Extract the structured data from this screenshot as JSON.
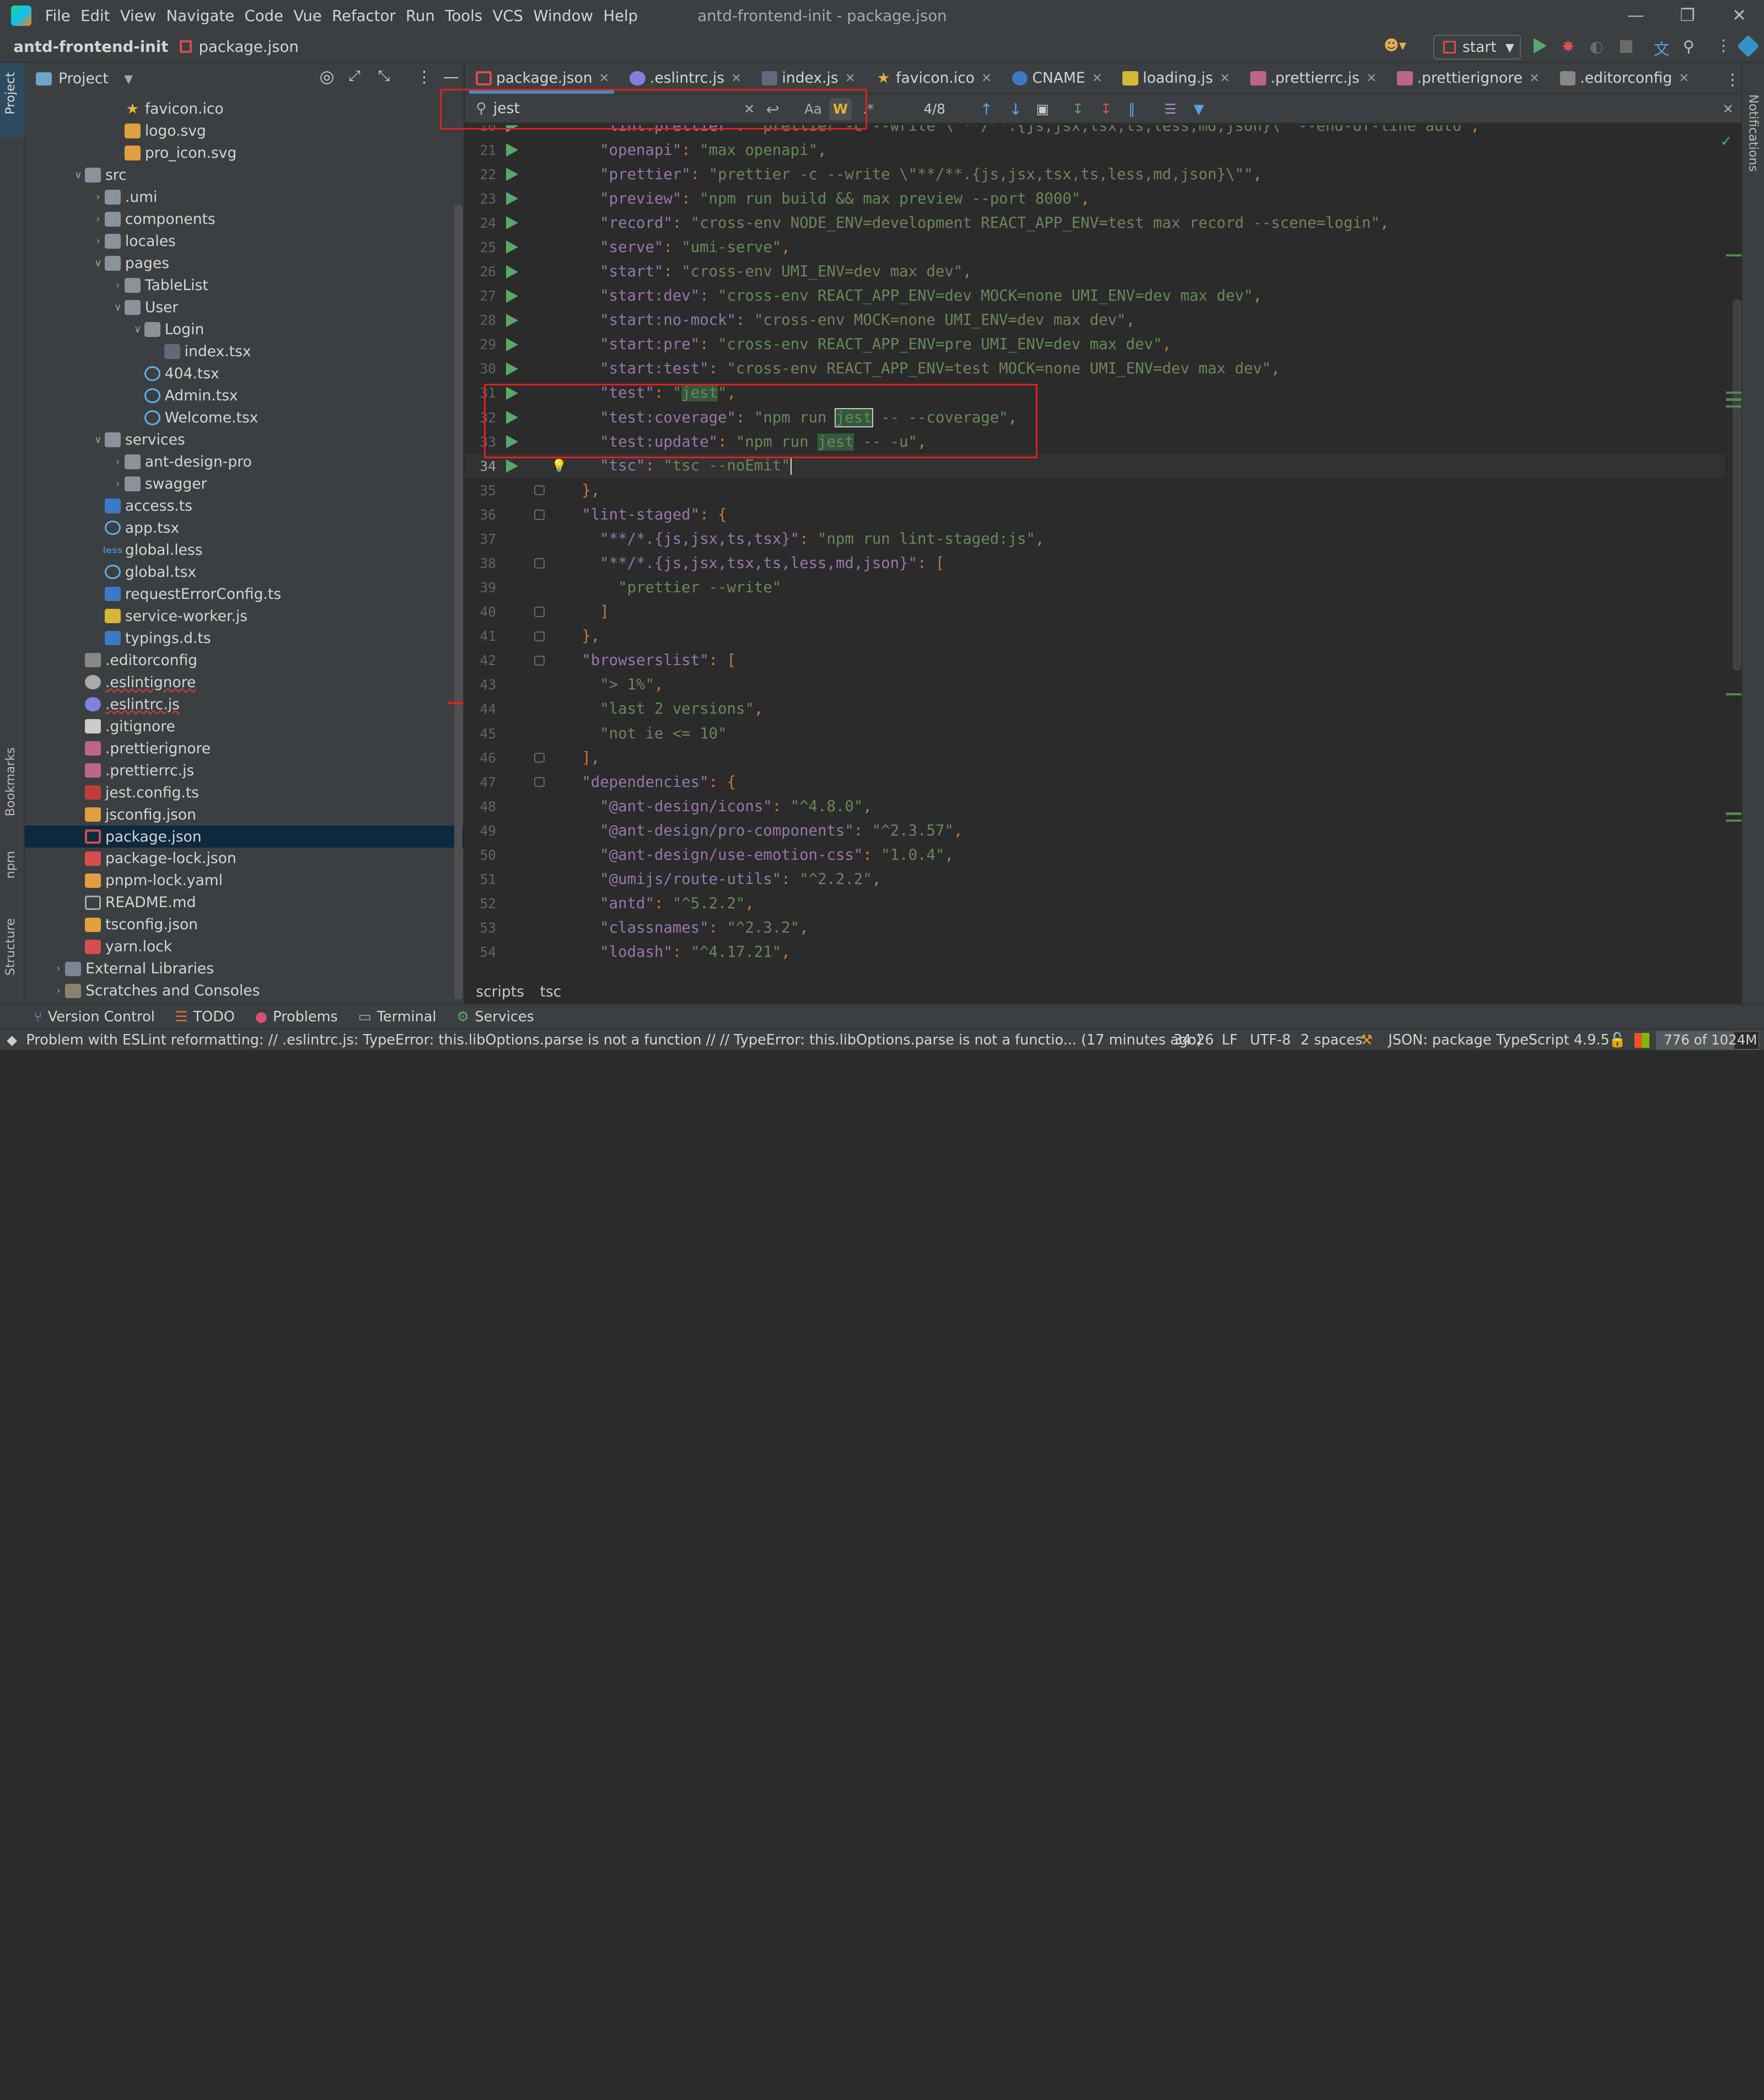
{
  "window_title": "antd-frontend-init - package.json",
  "menu": [
    "File",
    "Edit",
    "View",
    "Navigate",
    "Code",
    "Vue",
    "Refactor",
    "Run",
    "Tools",
    "VCS",
    "Window",
    "Help"
  ],
  "breadcrumb": {
    "project": "antd-frontend-init",
    "file": "package.json"
  },
  "run_config": "start",
  "left_strip": {
    "project": "Project",
    "bookmarks": "Bookmarks",
    "npm": "npm",
    "structure": "Structure"
  },
  "right_strip": {
    "notifications": "Notifications"
  },
  "project_panel": {
    "title": "Project"
  },
  "tree": [
    {
      "label": "favicon.ico",
      "depth": 3,
      "icon": "star-icon",
      "arrow": ""
    },
    {
      "label": "logo.svg",
      "depth": 3,
      "icon": "svg-icon",
      "arrow": ""
    },
    {
      "label": "pro_icon.svg",
      "depth": 3,
      "icon": "svg-icon",
      "arrow": ""
    },
    {
      "label": "src",
      "depth": 1,
      "icon": "folder-icon",
      "arrow": "down"
    },
    {
      "label": ".umi",
      "depth": 2,
      "icon": "folder-icon",
      "arrow": "right"
    },
    {
      "label": "components",
      "depth": 2,
      "icon": "folder-icon",
      "arrow": "right"
    },
    {
      "label": "locales",
      "depth": 2,
      "icon": "folder-icon",
      "arrow": "right"
    },
    {
      "label": "pages",
      "depth": 2,
      "icon": "folder-icon",
      "arrow": "down"
    },
    {
      "label": "TableList",
      "depth": 3,
      "icon": "folder-icon",
      "arrow": "right"
    },
    {
      "label": "User",
      "depth": 3,
      "icon": "folder-icon",
      "arrow": "down"
    },
    {
      "label": "Login",
      "depth": 4,
      "icon": "folder-icon",
      "arrow": "down"
    },
    {
      "label": "index.tsx",
      "depth": 5,
      "icon": "list-icon",
      "arrow": ""
    },
    {
      "label": "404.tsx",
      "depth": 4,
      "icon": "react-icon",
      "arrow": ""
    },
    {
      "label": "Admin.tsx",
      "depth": 4,
      "icon": "react-icon",
      "arrow": ""
    },
    {
      "label": "Welcome.tsx",
      "depth": 4,
      "icon": "react-icon",
      "arrow": ""
    },
    {
      "label": "services",
      "depth": 2,
      "icon": "folder-icon",
      "arrow": "down"
    },
    {
      "label": "ant-design-pro",
      "depth": 3,
      "icon": "folder-icon",
      "arrow": "right"
    },
    {
      "label": "swagger",
      "depth": 3,
      "icon": "folder-icon",
      "arrow": "right"
    },
    {
      "label": "access.ts",
      "depth": 2,
      "icon": "ts-icon",
      "arrow": ""
    },
    {
      "label": "app.tsx",
      "depth": 2,
      "icon": "react-icon",
      "arrow": ""
    },
    {
      "label": "global.less",
      "depth": 2,
      "icon": "less-icon",
      "arrow": ""
    },
    {
      "label": "global.tsx",
      "depth": 2,
      "icon": "react-icon",
      "arrow": ""
    },
    {
      "label": "requestErrorConfig.ts",
      "depth": 2,
      "icon": "ts-icon",
      "arrow": ""
    },
    {
      "label": "service-worker.js",
      "depth": 2,
      "icon": "js-icon",
      "arrow": ""
    },
    {
      "label": "typings.d.ts",
      "depth": 2,
      "icon": "ts-icon",
      "arrow": ""
    },
    {
      "label": ".editorconfig",
      "depth": 1,
      "icon": "gear-icon",
      "arrow": ""
    },
    {
      "label": ".eslintignore",
      "depth": 1,
      "icon": "circle-icon",
      "arrow": "",
      "warn": true
    },
    {
      "label": ".eslintrc.js",
      "depth": 1,
      "icon": "eslint-icon",
      "arrow": "",
      "warn": true
    },
    {
      "label": ".gitignore",
      "depth": 1,
      "icon": "git-icon",
      "arrow": ""
    },
    {
      "label": ".prettierignore",
      "depth": 1,
      "icon": "prettier-icon",
      "arrow": ""
    },
    {
      "label": ".prettierrc.js",
      "depth": 1,
      "icon": "prettier-icon",
      "arrow": ""
    },
    {
      "label": "jest.config.ts",
      "depth": 1,
      "icon": "jest-icon",
      "arrow": ""
    },
    {
      "label": "jsconfig.json",
      "depth": 1,
      "icon": "json-icon",
      "arrow": ""
    },
    {
      "label": "package.json",
      "depth": 1,
      "icon": "npm-icon",
      "arrow": "",
      "selected": true
    },
    {
      "label": "package-lock.json",
      "depth": 1,
      "icon": "lock-icon",
      "arrow": ""
    },
    {
      "label": "pnpm-lock.yaml",
      "depth": 1,
      "icon": "yaml-icon",
      "arrow": ""
    },
    {
      "label": "README.md",
      "depth": 1,
      "icon": "md-icon",
      "arrow": ""
    },
    {
      "label": "tsconfig.json",
      "depth": 1,
      "icon": "json-icon",
      "arrow": ""
    },
    {
      "label": "yarn.lock",
      "depth": 1,
      "icon": "lock-icon",
      "arrow": ""
    },
    {
      "label": "External Libraries",
      "depth": 0,
      "icon": "library-icon",
      "arrow": "right"
    },
    {
      "label": "Scratches and Consoles",
      "depth": 0,
      "icon": "scratch-icon",
      "arrow": "right"
    }
  ],
  "tabs": [
    {
      "label": "package.json",
      "icon": "npm-icon",
      "active": true
    },
    {
      "label": ".eslintrc.js",
      "icon": "eslint-icon"
    },
    {
      "label": "index.js",
      "icon": "list-icon"
    },
    {
      "label": "favicon.ico",
      "icon": "star-icon"
    },
    {
      "label": "CNAME",
      "icon": "globe-icon"
    },
    {
      "label": "loading.js",
      "icon": "js-icon"
    },
    {
      "label": ".prettierrc.js",
      "icon": "prettier-icon"
    },
    {
      "label": ".prettierignore",
      "icon": "prettier-icon"
    },
    {
      "label": ".editorconfig",
      "icon": "gear-icon"
    }
  ],
  "search": {
    "query": "jest",
    "count": "4/8",
    "case_label": "Aa",
    "word_label": "W",
    "regex_label": ".*"
  },
  "code_lines": [
    {
      "n": "20",
      "run": true,
      "t": "    \"lint:prettier\": \"prettier -c --write \\\"**/**.{js,jsx,tsx,ts,less,md,json}\\\" --end-of-line auto\","
    },
    {
      "n": "21",
      "run": true,
      "t": "    \"openapi\": \"max openapi\","
    },
    {
      "n": "22",
      "run": true,
      "t": "    \"prettier\": \"prettier -c --write \\\"**/**.{js,jsx,tsx,ts,less,md,json}\\\"\","
    },
    {
      "n": "23",
      "run": true,
      "t": "    \"preview\": \"npm run build && max preview --port 8000\","
    },
    {
      "n": "24",
      "run": true,
      "t": "    \"record\": \"cross-env NODE_ENV=development REACT_APP_ENV=test max record --scene=login\","
    },
    {
      "n": "25",
      "run": true,
      "t": "    \"serve\": \"umi-serve\","
    },
    {
      "n": "26",
      "run": true,
      "t": "    \"start\": \"cross-env UMI_ENV=dev max dev\","
    },
    {
      "n": "27",
      "run": true,
      "t": "    \"start:dev\": \"cross-env REACT_APP_ENV=dev MOCK=none UMI_ENV=dev max dev\","
    },
    {
      "n": "28",
      "run": true,
      "t": "    \"start:no-mock\": \"cross-env MOCK=none UMI_ENV=dev max dev\","
    },
    {
      "n": "29",
      "run": true,
      "t": "    \"start:pre\": \"cross-env REACT_APP_ENV=pre UMI_ENV=dev max dev\","
    },
    {
      "n": "30",
      "run": true,
      "t": "    \"start:test\": \"cross-env REACT_APP_ENV=test MOCK=none UMI_ENV=dev max dev\","
    },
    {
      "n": "31",
      "run": true,
      "t": "    \"test\": \"jest\","
    },
    {
      "n": "32",
      "run": true,
      "t": "    \"test:coverage\": \"npm run jest -- --coverage\","
    },
    {
      "n": "33",
      "run": true,
      "t": "    \"test:update\": \"npm run jest -- -u\","
    },
    {
      "n": "34",
      "run": true,
      "t": "    \"tsc\": \"tsc --noEmit\"",
      "current": true
    },
    {
      "n": "35",
      "t": "  },",
      "fold": true
    },
    {
      "n": "36",
      "t": "  \"lint-staged\": {",
      "fold": true
    },
    {
      "n": "37",
      "t": "    \"**/*.{js,jsx,ts,tsx}\": \"npm run lint-staged:js\","
    },
    {
      "n": "38",
      "t": "    \"**/*.{js,jsx,tsx,ts,less,md,json}\": [",
      "fold": true
    },
    {
      "n": "39",
      "t": "      \"prettier --write\""
    },
    {
      "n": "40",
      "t": "    ]",
      "fold": true
    },
    {
      "n": "41",
      "t": "  },",
      "fold": true
    },
    {
      "n": "42",
      "t": "  \"browserslist\": [",
      "fold": true
    },
    {
      "n": "43",
      "t": "    \"> 1%\","
    },
    {
      "n": "44",
      "t": "    \"last 2 versions\","
    },
    {
      "n": "45",
      "t": "    \"not ie <= 10\""
    },
    {
      "n": "46",
      "t": "  ],",
      "fold": true
    },
    {
      "n": "47",
      "t": "  \"dependencies\": {",
      "fold": true
    },
    {
      "n": "48",
      "t": "    \"@ant-design/icons\": \"^4.8.0\","
    },
    {
      "n": "49",
      "t": "    \"@ant-design/pro-components\": \"^2.3.57\","
    },
    {
      "n": "50",
      "t": "    \"@ant-design/use-emotion-css\": \"1.0.4\","
    },
    {
      "n": "51",
      "t": "    \"@umijs/route-utils\": \"^2.2.2\","
    },
    {
      "n": "52",
      "t": "    \"antd\": \"^5.2.2\","
    },
    {
      "n": "53",
      "t": "    \"classnames\": \"^2.3.2\","
    },
    {
      "n": "54",
      "t": "    \"lodash\": \"^4.17.21\","
    }
  ],
  "editor_breadcrumb": [
    "scripts",
    "tsc"
  ],
  "tool_windows": [
    "Version Control",
    "TODO",
    "Problems",
    "Terminal",
    "Services"
  ],
  "status": {
    "message": "Problem with ESLint reformatting: // .eslintrc.js: TypeError: this.libOptions.parse is not a function // // TypeError: this.libOptions.parse is not a functio... (17 minutes ago)",
    "position": "34:26",
    "line_sep": "LF",
    "encoding": "UTF-8",
    "indent": "2 spaces",
    "schema": "JSON: package",
    "ts_version": "TypeScript 4.9.5",
    "memory": "776 of 1024M",
    "memory_fraction": 0.76
  },
  "colors": {
    "accent": "#4a88c7",
    "run_green": "#59a869",
    "match_bg": "#32593d",
    "annotation_red": "#e02020"
  }
}
